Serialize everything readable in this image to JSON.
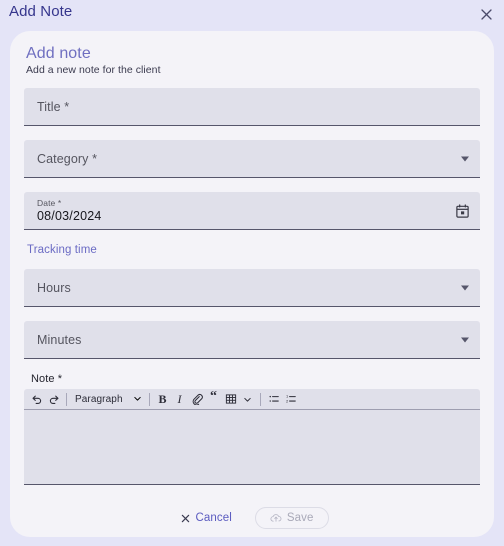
{
  "dialog": {
    "title": "Add Note",
    "close_icon": "close-icon"
  },
  "card": {
    "heading": "Add note",
    "subheading": "Add a new note for the client"
  },
  "form": {
    "title_field": {
      "placeholder": "Title *",
      "value": ""
    },
    "category_field": {
      "placeholder": "Category *",
      "value": "",
      "caret_icon": "chevron-down-icon"
    },
    "date_field": {
      "label": "Date *",
      "value": "08/03/2024",
      "calendar_icon": "calendar-icon"
    },
    "tracking_time_label": "Tracking time",
    "hours_field": {
      "placeholder": "Hours",
      "value": "",
      "caret_icon": "chevron-down-icon"
    },
    "minutes_field": {
      "placeholder": "Minutes",
      "value": "",
      "caret_icon": "chevron-down-icon"
    },
    "note": {
      "label": "Note *",
      "value": "",
      "toolbar": {
        "undo": "undo-icon",
        "redo": "redo-icon",
        "style_select": "Paragraph",
        "style_caret": "chevron-down-icon",
        "bold": "B",
        "italic": "I",
        "link": "link-icon",
        "blockquote": "“",
        "table": "table-icon",
        "table_caret": "chevron-down-icon",
        "bullet_list": "bullet-list-icon",
        "numbered_list": "numbered-list-icon"
      }
    }
  },
  "footer": {
    "cancel_label": "Cancel",
    "cancel_icon": "close-icon",
    "save_label": "Save",
    "save_icon": "cloud-upload-icon"
  },
  "colors": {
    "page_background": "#e4e4f7",
    "card_background": "#f4f3f8",
    "field_background": "#e0e0ea",
    "accent": "#6b6bc4",
    "title_text": "#35358c"
  }
}
